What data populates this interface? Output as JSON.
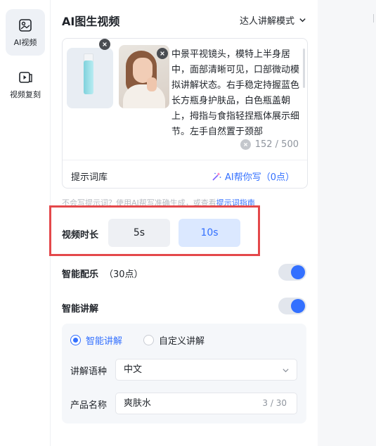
{
  "nav": {
    "items": [
      {
        "label": "AI视频",
        "icon": "image-video-icon",
        "active": true
      },
      {
        "label": "视频复刻",
        "icon": "video-copy-icon",
        "active": false
      }
    ]
  },
  "panel": {
    "title": "AI图生视频",
    "mode_label": "达人讲解模式"
  },
  "prompt": {
    "text": "中景平视镜头，模特上半身居中，面部清晰可见，口部微动模拟讲解状态。右手稳定持握蓝色长方瓶身护肤品，白色瓶盖朝上，拇指与食指轻捏瓶体展示细节。左手自然置于颈部",
    "count": "152 / 500",
    "library_label": "提示词库",
    "ai_write_label": "AI帮你写（0点）"
  },
  "hint": {
    "text": "不会写提示词？使用AI帮写准确生成，或查看",
    "link": "提示词指南"
  },
  "duration": {
    "label": "视频时长",
    "options": [
      "5s",
      "10s"
    ],
    "selected": "10s"
  },
  "music": {
    "label": "智能配乐",
    "points": "（30点）",
    "enabled": true
  },
  "narration": {
    "label": "智能讲解",
    "enabled": true,
    "modes": [
      "智能讲解",
      "自定义讲解"
    ],
    "selected_mode": "智能讲解",
    "language_label": "讲解语种",
    "language_value": "中文",
    "product_label": "产品名称",
    "product_value": "爽肤水",
    "product_count": "3 / 30"
  },
  "colors": {
    "accent": "#3370ff",
    "highlight_border": "#e4484b",
    "selected_option_bg": "#dbe8ff"
  }
}
